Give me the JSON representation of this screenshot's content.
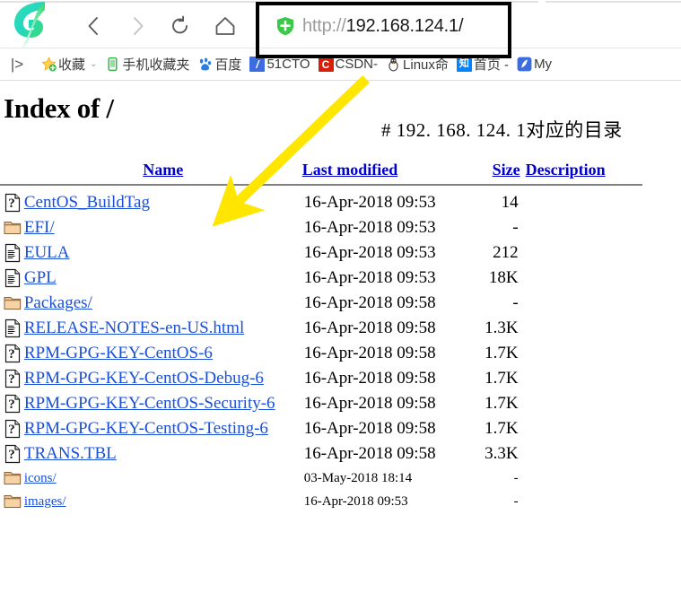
{
  "browser": {
    "logo_icon": "browser-logo-icon",
    "nav": [
      {
        "name": "back-button",
        "icon": "chevron-left-icon",
        "label": "Back"
      },
      {
        "name": "forward-button",
        "icon": "chevron-right-icon",
        "label": "Forward"
      },
      {
        "name": "reload-button",
        "icon": "reload-icon",
        "label": "Reload"
      },
      {
        "name": "home-button",
        "icon": "home-icon",
        "label": "Home"
      }
    ],
    "omnibox": {
      "shield_icon": "green-shield-plus-icon",
      "scheme": "http://",
      "host_path": "192.168.124.1/",
      "full_url": "http://192.168.124.1/",
      "placeholder": "http://192.168.124.1/"
    },
    "bookmarks": {
      "overflow_label": "|>",
      "items": [
        {
          "label": "收藏",
          "icon": "star-add-icon",
          "icon_color": "#ffc93c",
          "caret": "⌄"
        },
        {
          "label": "手机收藏夹",
          "icon": "phone-icon",
          "icon_color": "#3ab54a"
        },
        {
          "label": "百度",
          "icon": "baidu-paw-icon",
          "icon_color": "#2b7fe0"
        },
        {
          "label": "51CTO",
          "icon": "blue-square-icon",
          "icon_color": "#3d6ce0",
          "icon_text": "/"
        },
        {
          "label": "CSDN-",
          "icon": "red-square-icon",
          "icon_color": "#d81e06",
          "icon_text": "C"
        },
        {
          "label": "Linux命",
          "icon": "penguin-icon",
          "icon_color": "#4a4a4a"
        },
        {
          "label": "首页 -",
          "icon": "zhihu-square-icon",
          "icon_color": "#0084ff",
          "icon_text": "知"
        },
        {
          "label": "My",
          "icon": "feather-square-icon",
          "icon_color": "#3d6ce0",
          "icon_text": "✎"
        }
      ]
    }
  },
  "page": {
    "title": "Index of /",
    "annotation_note": "# 192. 168. 124. 1对应的目录",
    "columns": [
      {
        "key": "icon",
        "label": ""
      },
      {
        "key": "name",
        "label": "Name"
      },
      {
        "key": "modified",
        "label": "Last modified"
      },
      {
        "key": "size",
        "label": "Size"
      },
      {
        "key": "description",
        "label": "Description"
      }
    ],
    "rows": [
      {
        "icon": "unknown-file-icon",
        "name": "CentOS_BuildTag",
        "modified": "16-Apr-2018 09:53",
        "size": "14",
        "description": ""
      },
      {
        "icon": "folder-icon",
        "name": "EFI/",
        "modified": "16-Apr-2018 09:53",
        "size": "-",
        "description": ""
      },
      {
        "icon": "text-file-icon",
        "name": "EULA",
        "modified": "16-Apr-2018 09:53",
        "size": "212",
        "description": ""
      },
      {
        "icon": "text-file-icon",
        "name": "GPL",
        "modified": "16-Apr-2018 09:53",
        "size": "18K",
        "description": ""
      },
      {
        "icon": "folder-icon",
        "name": "Packages/",
        "modified": "16-Apr-2018 09:58",
        "size": "-",
        "description": ""
      },
      {
        "icon": "text-file-icon",
        "name": "RELEASE-NOTES-en-US.html",
        "modified": "16-Apr-2018 09:58",
        "size": "1.3K",
        "description": ""
      },
      {
        "icon": "unknown-file-icon",
        "name": "RPM-GPG-KEY-CentOS-6",
        "modified": "16-Apr-2018 09:58",
        "size": "1.7K",
        "description": ""
      },
      {
        "icon": "unknown-file-icon",
        "name": "RPM-GPG-KEY-CentOS-Debug-6",
        "modified": "16-Apr-2018 09:58",
        "size": "1.7K",
        "description": ""
      },
      {
        "icon": "unknown-file-icon",
        "name": "RPM-GPG-KEY-CentOS-Security-6",
        "modified": "16-Apr-2018 09:58",
        "size": "1.7K",
        "description": ""
      },
      {
        "icon": "unknown-file-icon",
        "name": "RPM-GPG-KEY-CentOS-Testing-6",
        "modified": "16-Apr-2018 09:58",
        "size": "1.7K",
        "description": ""
      },
      {
        "icon": "unknown-file-icon",
        "name": "TRANS.TBL",
        "modified": "16-Apr-2018 09:58",
        "size": "3.3K",
        "description": ""
      },
      {
        "icon": "folder-icon",
        "name": "icons/",
        "modified": "03-May-2018 18:14",
        "size": "-",
        "description": "",
        "small": true
      },
      {
        "icon": "folder-icon",
        "name": "images/",
        "modified": "16-Apr-2018 09:53",
        "size": "-",
        "description": "",
        "small": true
      }
    ]
  },
  "annotations": {
    "highlight_box_color": "#000000",
    "arrow_color": "#ffe600",
    "arrow_label": "address-bar-callout-arrow"
  }
}
